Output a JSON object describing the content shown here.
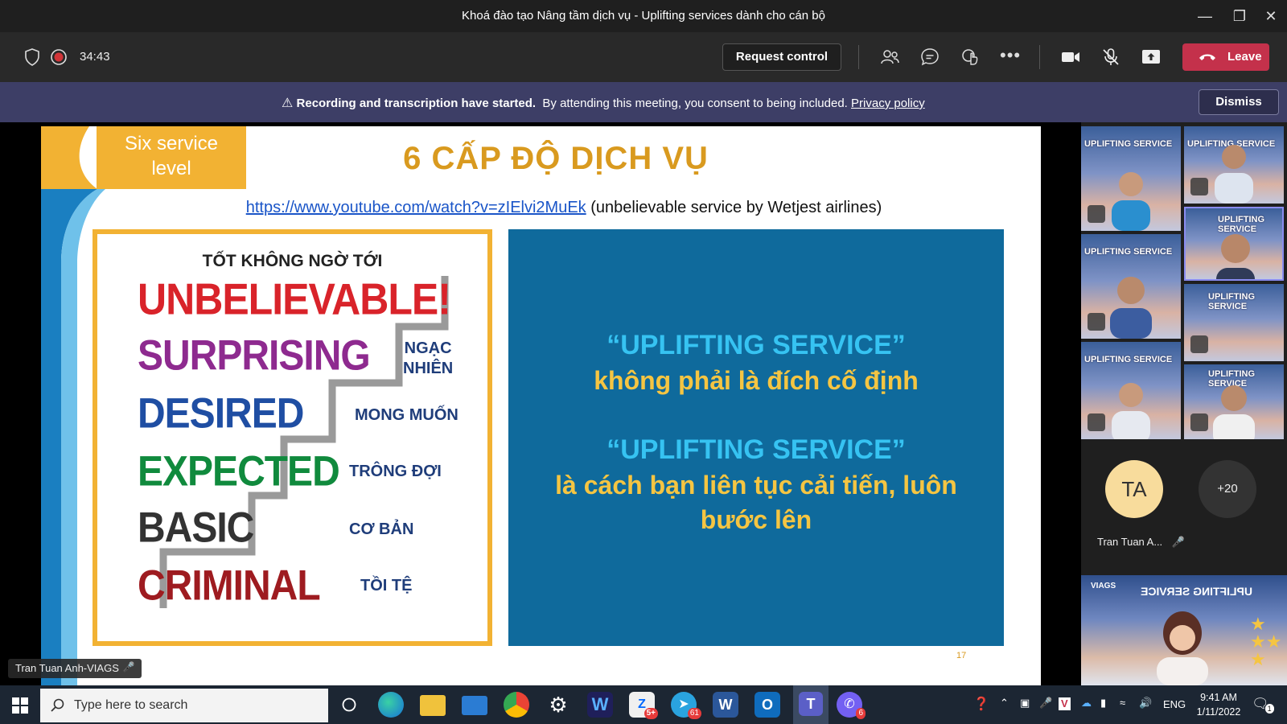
{
  "window": {
    "title": "Khoá đào tạo Nâng tầm dịch vụ - Uplifting services dành cho cán bộ"
  },
  "toolbar": {
    "timer": "34:43",
    "request_control_label": "Request control",
    "leave_label": "Leave"
  },
  "banner": {
    "bold_text": "Recording and transcription have started.",
    "text": "By attending this meeting, you consent to being included.",
    "link_text": "Privacy policy",
    "dismiss_label": "Dismiss"
  },
  "slide": {
    "corner_label_line1": "Six service",
    "corner_label_line2": "level",
    "title": "6 CẤP ĐỘ DỊCH VỤ",
    "url": "https://www.youtube.com/watch?v=zIElvi2MuEk",
    "url_suffix": "(unbelievable service by Wetjest airlines)",
    "ladder_heading": "TỐT KHÔNG NGỜ TỚI",
    "levels": [
      {
        "en": "UNBELIEVABLE!",
        "vi": "",
        "color": "#d9232a"
      },
      {
        "en": "SURPRISING",
        "vi_line1": "NGẠC",
        "vi_line2": "NHIÊN",
        "color": "#8e2a8f"
      },
      {
        "en": "DESIRED",
        "vi": "MONG MUỐN",
        "color": "#1f4ea3"
      },
      {
        "en": "EXPECTED",
        "vi": "TRÔNG ĐỢI",
        "color": "#108a3d"
      },
      {
        "en": "BASIC",
        "vi": "CƠ BẢN",
        "color": "#333333"
      },
      {
        "en": "CRIMINAL",
        "vi": "TỒI TỆ",
        "color": "#9e1b20"
      }
    ],
    "panel_quote1": "“UPLIFTING SERVICE”",
    "panel_text1": "không phải là đích cố định",
    "panel_quote2": "“UPLIFTING SERVICE”",
    "panel_text2_line1": "là cách bạn liên tục cải tiến, luôn",
    "panel_text2_line2": "bước lên",
    "page_number": "17",
    "presenter_label": "Tran Tuan Anh-VIAGS"
  },
  "participants": {
    "tile_banner": "UPLIFTING SERVICE",
    "avatar_initials": "TA",
    "avatar_name": "Tran Tuan A...",
    "overflow_count": "+20",
    "bottom_banner": "UPLIFTING SERVICE",
    "bottom_logo": "VIAGS"
  },
  "taskbar": {
    "search_placeholder": "Type here to search",
    "zalo_badge": "5+",
    "telegram_badge": "61",
    "viber_badge": "6",
    "language": "ENG",
    "time": "9:41 AM",
    "date": "1/11/2022",
    "notification_count": "1"
  },
  "colors": {
    "teams_purple": "#3d3e66",
    "leave_red": "#c4314b",
    "slide_blue_panel": "#0f6a9c",
    "slide_gold": "#f2b233",
    "panel_text_gold": "#f5c542",
    "panel_quote_cyan": "#36c3f2"
  }
}
